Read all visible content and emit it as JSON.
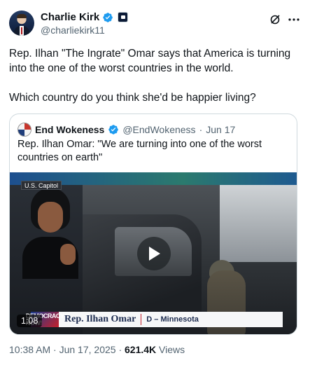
{
  "author": {
    "name": "Charlie Kirk",
    "handle": "@charliekirk11"
  },
  "tweet": {
    "line1": "Rep. Ilhan \"The Ingrate\" Omar says that America is turning into the one of the worst countries in the world.",
    "line2": "Which country do you think she'd be happier living?"
  },
  "quoted": {
    "name": "End Wokeness",
    "handle": "@EndWokeness",
    "separator": "·",
    "date": "Jun 17",
    "text": "Rep. Ilhan Omar: \"We are turning into one of the worst countries on earth\""
  },
  "video": {
    "location_tag": "U.S. Capitol",
    "duration": "1:08",
    "network_logo": "DEMOCRACY NOW!",
    "lower_third_name": "Rep. Ilhan Omar",
    "lower_third_party": "D – Minnesota"
  },
  "meta": {
    "time_date": "10:38 AM · Jun 17, 2025 ·",
    "views_count": "621.4K",
    "views_label": "Views"
  },
  "colors": {
    "verified_blue": "#1d9bf0",
    "secondary_text": "#536471",
    "border": "#cfd9de"
  },
  "icons": {
    "verified": "verified-badge-icon",
    "affiliate": "affiliate-badge-icon",
    "grok": "grok-icon",
    "more": "more-dots-icon",
    "play": "play-icon"
  }
}
